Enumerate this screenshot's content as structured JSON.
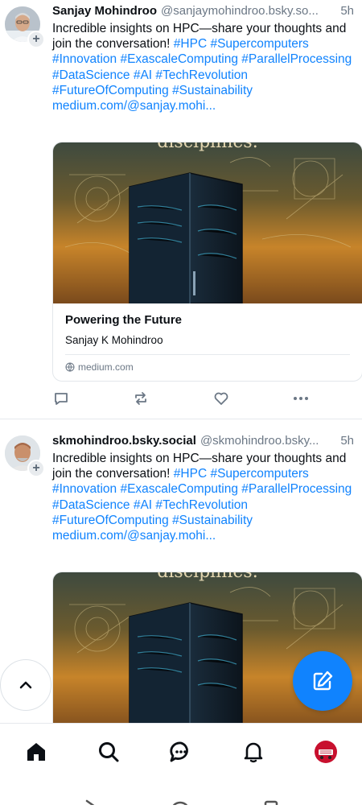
{
  "posts": [
    {
      "display_name": "Sanjay Mohindroo",
      "handle": "@sanjaymohindroo.bsky.so...",
      "time": "5h",
      "text_plain": "Incredible insights on HPC—share your thoughts and join the conversation! ",
      "hashtags": [
        "#HPC",
        "#Supercomputers",
        "#Innovation",
        "#ExascaleComputing",
        "#ParallelProcessing",
        "#DataScience",
        "#AI",
        "#TechRevolution",
        "#FutureOfComputing",
        "#Sustainability"
      ],
      "link": "medium.com/@sanjay.mohi...",
      "card": {
        "title": "Powering the Future",
        "description": "Sanjay K Mohindroo",
        "domain": "medium.com",
        "image_caption": "disciplines."
      }
    },
    {
      "display_name": "skmohindroo.bsky.social",
      "handle": "@skmohindroo.bsky...",
      "time": "5h",
      "text_plain": "Incredible insights on HPC—share your thoughts and join the conversation! ",
      "hashtags": [
        "#HPC",
        "#Supercomputers",
        "#Innovation",
        "#ExascaleComputing",
        "#ParallelProcessing",
        "#DataScience",
        "#AI",
        "#TechRevolution",
        "#FutureOfComputing",
        "#Sustainability"
      ],
      "link": "medium.com/@sanjay.mohi...",
      "card": {
        "image_caption": "disciplines."
      }
    }
  ],
  "icons": {
    "reply": "reply-icon",
    "repost": "repost-icon",
    "like": "heart-icon",
    "more": "more-icon",
    "scroll_top": "chevron-up-icon",
    "compose": "compose-icon",
    "nav": [
      "home-icon",
      "search-icon",
      "chat-icon",
      "bell-icon",
      "profile-avatar"
    ]
  },
  "colors": {
    "accent": "#1083fe",
    "text": "#0b0f14",
    "muted": "#6b7785"
  }
}
